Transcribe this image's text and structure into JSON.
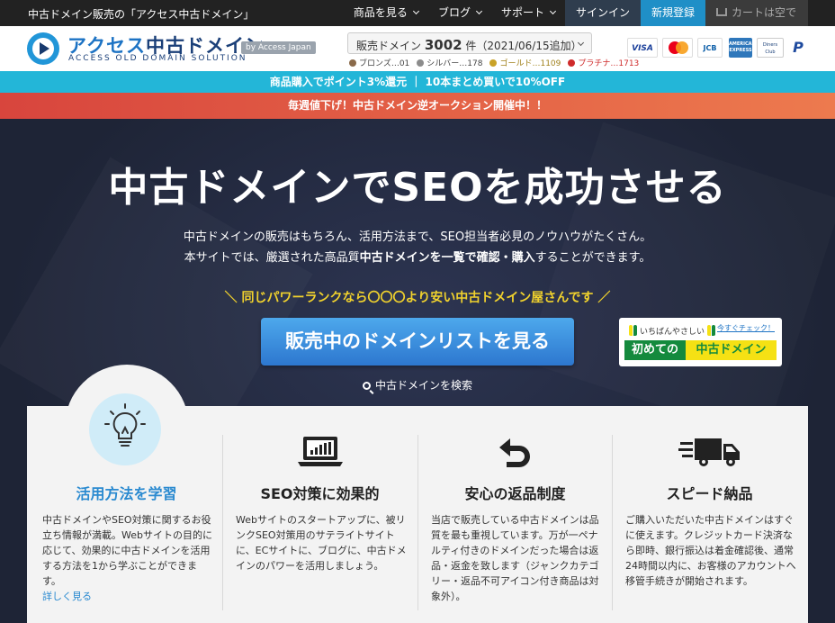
{
  "topbar": {
    "tagline": "中古ドメイン販売の「アクセス中古ドメイン」",
    "nav": [
      {
        "label": "商品を見る"
      },
      {
        "label": "ブログ"
      },
      {
        "label": "サポート"
      }
    ],
    "signin": "サインイン",
    "register": "新規登録",
    "cart": "カートは空です"
  },
  "header": {
    "logo_kata": "アクセス",
    "logo_kanji": "中古ドメイン",
    "logo_sub": "ACCESS OLD DOMAIN SOLUTION",
    "by": "by Access Japan",
    "domain_count_prefix": "販売ドメイン",
    "domain_count": "3002",
    "domain_count_suffix": "件（2021/06/15追加）",
    "ranks": [
      {
        "label": "ブロンズ…01",
        "color": "#8a6a4a"
      },
      {
        "label": "シルバー…178",
        "color": "#8c8c8c"
      },
      {
        "label": "ゴールド…1109",
        "color": "#c9a227"
      },
      {
        "label": "プラチナ…1713",
        "color": "#cf2b2b"
      }
    ],
    "payments": [
      {
        "label": "VISA",
        "color": "#1a3f9a"
      },
      {
        "label": "mastercard",
        "color": "#ffffff"
      },
      {
        "label": "JCB",
        "color": "#0b5ea8"
      },
      {
        "label": "AMERICAN EXPRESS",
        "color": "#2e77bb"
      },
      {
        "label": "Diners Club",
        "color": "#ffffff"
      },
      {
        "label": "P",
        "color": "#1e4a9e"
      }
    ]
  },
  "promo": {
    "line1": "商品購入でポイント3%還元 ｜ 10本まとめ買いで10%OFF",
    "line2": "毎週値下げ！中古ドメイン逆オークション開催中！！"
  },
  "hero": {
    "title": "中古ドメインでSEOを成功させる",
    "desc1": "中古ドメインの販売はもちろん、活用方法まで、SEO担当者必見のノウハウがたくさん。",
    "desc2_pre": "本サイトでは、厳選された高品質",
    "desc2_bold": "中古ドメインを一覧で確認・購入",
    "desc2_post": "することができます。",
    "catch": "＼ 同じパワーランクなら〇〇〇より安い中古ドメイン屋さんです ／",
    "cta": "販売中のドメインリストを見る",
    "beginner_small": "いちばんやさしい",
    "beginner_check": "今すぐチェック！",
    "beginner_green": "初めての",
    "beginner_yellow": "中古ドメイン",
    "search_link": "中古ドメインを検索"
  },
  "features": [
    {
      "title": "活用方法を学習",
      "text": "中古ドメインやSEO対策に関するお役立ち情報が満載。Webサイトの目的に応じて、効果的に中古ドメインを活用する方法を1から学ぶことができます。",
      "link": "詳しく見る",
      "icon": "lightbulb-icon",
      "title_color": "#2a8ad0"
    },
    {
      "title": "SEO対策に効果的",
      "text": "Webサイトのスタートアップに、被リンクSEO対策用のサテライトサイトに、ECサイトに、ブログに、中古ドメインのパワーを活用しましょう。",
      "icon": "laptop-chart-icon"
    },
    {
      "title": "安心の返品制度",
      "text": "当店で販売している中古ドメインは品質を最も重視しています。万が一ペナルティ付きのドメインだった場合は返品・返金を致します（ジャンクカテゴリー・返品不可アイコン付き商品は対象外）。",
      "icon": "return-arrow-icon"
    },
    {
      "title": "スピード納品",
      "text": "ご購入いただいた中古ドメインはすぐに使えます。クレジットカード決済なら即時、銀行振込は着金確認後、通常24時間以内に、お客様のアカウントへ移管手続きが開始されます。",
      "icon": "delivery-truck-icon"
    }
  ]
}
